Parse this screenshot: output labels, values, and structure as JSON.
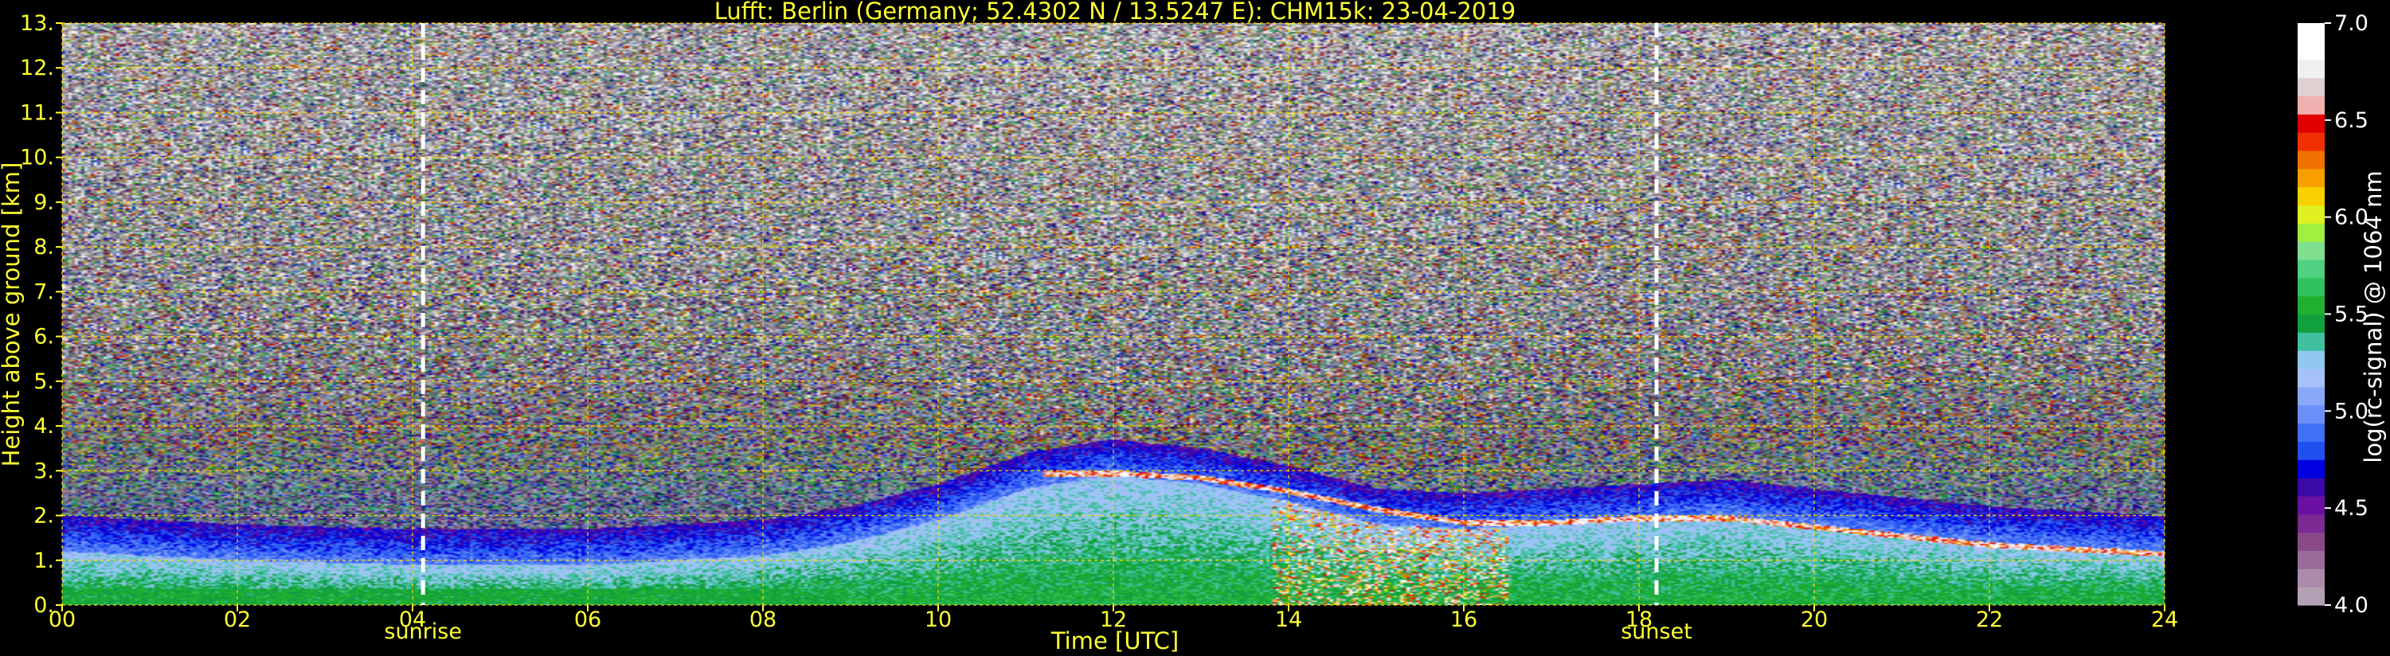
{
  "chart_data": {
    "type": "heatmap",
    "title": "Lufft: Berlin (Germany; 52.4302 N / 13.5247 E):    CHM15k: 23-04-2019",
    "xlabel": "Time [UTC]",
    "ylabel": "Height above ground [km]",
    "xlim": [
      0,
      24
    ],
    "ylim": [
      0,
      13
    ],
    "x_ticks": [
      0,
      2,
      4,
      6,
      8,
      10,
      12,
      14,
      16,
      18,
      20,
      22,
      24
    ],
    "x_tick_labels": [
      "00",
      "02",
      "04",
      "06",
      "08",
      "10",
      "12",
      "14",
      "16",
      "18",
      "20",
      "22",
      "24"
    ],
    "y_ticks": [
      0,
      1,
      2,
      3,
      4,
      5,
      6,
      7,
      8,
      9,
      10,
      11,
      12,
      13
    ],
    "y_tick_labels": [
      "0.",
      "1.",
      "2.",
      "3.",
      "4.",
      "5.",
      "6.",
      "7.",
      "8.",
      "9.",
      "10.",
      "11.",
      "12.",
      "13."
    ],
    "grid": true,
    "grid_color": "#ffd700",
    "events": [
      {
        "label": "sunrise",
        "time": 4.12
      },
      {
        "label": "sunset",
        "time": 18.2
      }
    ],
    "colorbar": {
      "label": "log(rc-signal) @ 1064 nm",
      "range": [
        4.0,
        7.0
      ],
      "ticks": [
        4.0,
        4.5,
        5.0,
        5.5,
        6.0,
        6.5,
        7.0
      ],
      "tick_labels": [
        "4.0",
        "4.5",
        "5.0",
        "5.5",
        "6.0",
        "6.5",
        "7.0"
      ],
      "colors": [
        "#b4a0b4",
        "#aa8caa",
        "#9a6a9a",
        "#8a4a8a",
        "#7a2a90",
        "#6a10a0",
        "#3a0aa8",
        "#0000e0",
        "#2050f0",
        "#4070f8",
        "#6a90f8",
        "#8aa8f8",
        "#a8c0f8",
        "#90c8f0",
        "#40c0a0",
        "#10a040",
        "#20b030",
        "#30c060",
        "#50d080",
        "#80e090",
        "#a0f040",
        "#e0f020",
        "#f8d000",
        "#f8a000",
        "#f07000",
        "#f03000",
        "#e00000",
        "#f0b0b0",
        "#e0d0d0",
        "#f0f0f0",
        "#ffffff",
        "#ffffff"
      ]
    },
    "boundary_layer_top_km": {
      "x": [
        0,
        1,
        2,
        3,
        4,
        5,
        6,
        7,
        8,
        9,
        10,
        11,
        12,
        13,
        14,
        15,
        16,
        17,
        18,
        19,
        20,
        21,
        22,
        23,
        24
      ],
      "y": [
        1.2,
        1.1,
        1.0,
        0.95,
        0.9,
        0.9,
        0.9,
        1.0,
        1.1,
        1.4,
        1.9,
        2.6,
        2.9,
        2.7,
        2.3,
        1.8,
        1.7,
        1.8,
        1.9,
        2.0,
        1.8,
        1.6,
        1.4,
        1.3,
        1.2
      ]
    },
    "cloud_top_km": {
      "x": [
        11.2,
        12,
        13,
        14,
        15,
        16,
        17,
        18,
        19,
        20,
        21,
        22,
        23,
        24
      ],
      "y": [
        3.0,
        3.0,
        2.9,
        2.6,
        2.2,
        1.9,
        1.9,
        2.0,
        2.0,
        1.8,
        1.6,
        1.4,
        1.3,
        1.2
      ]
    }
  }
}
